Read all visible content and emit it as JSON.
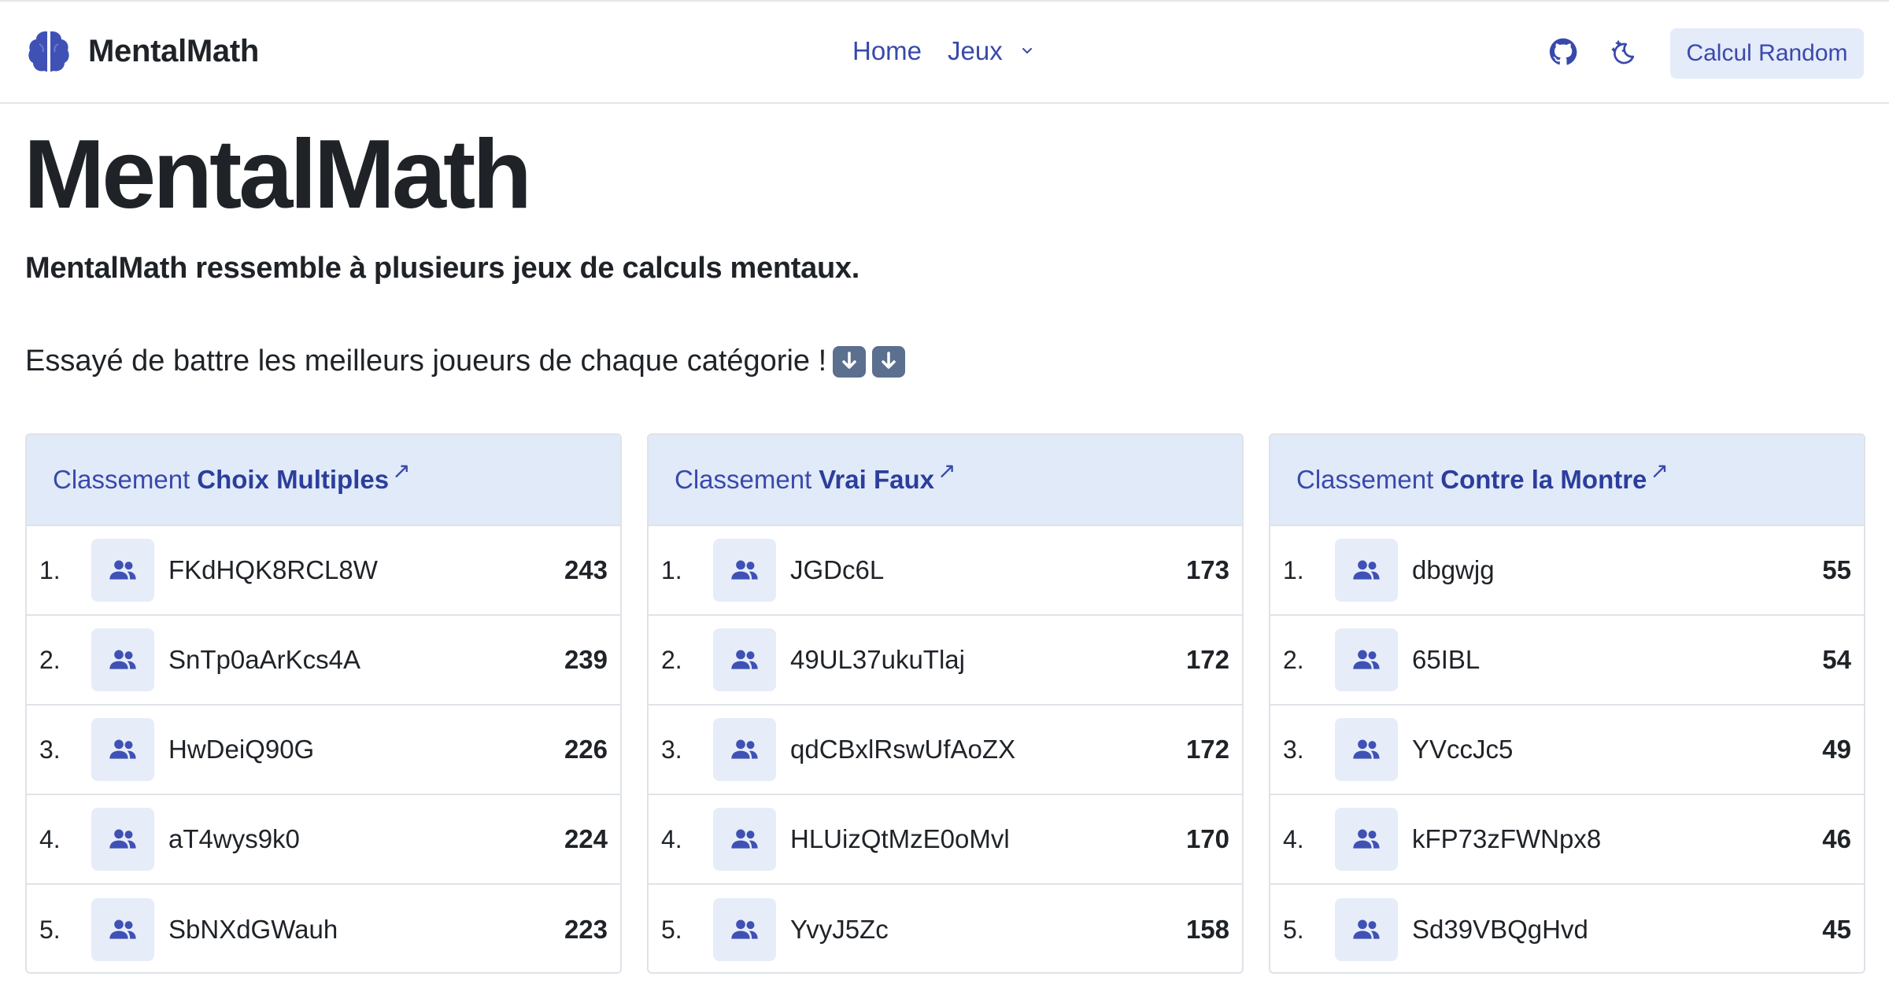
{
  "app": {
    "name": "MentalMath"
  },
  "nav": {
    "home": "Home",
    "games": "Jeux",
    "cta": "Calcul Random"
  },
  "icons": {
    "logo": "brain-icon",
    "github": "github-icon",
    "theme": "moon-stars-icon",
    "dropdown": "chevron-down-icon",
    "player": "users-icon",
    "external": "arrow-up-right-icon",
    "emoji": "down-arrow-emoji"
  },
  "colors": {
    "accent": "#3949ab",
    "header_bg": "#e1eaf9",
    "button_bg": "#e4ebf9"
  },
  "hero": {
    "title": "MentalMath",
    "subtitle": "MentalMath ressemble à plusieurs jeux de calculs mentaux.",
    "cta_text": "Essayé de battre les meilleurs joueurs de chaque catégorie !"
  },
  "leaderboards": [
    {
      "prefix": "Classement",
      "name": "Choix Multiples",
      "arrow": "↗",
      "rows": [
        {
          "rank": "1.",
          "player": "FKdHQK8RCL8W",
          "score": "243"
        },
        {
          "rank": "2.",
          "player": "SnTp0aArKcs4A",
          "score": "239"
        },
        {
          "rank": "3.",
          "player": "HwDeiQ90G",
          "score": "226"
        },
        {
          "rank": "4.",
          "player": "aT4wys9k0",
          "score": "224"
        },
        {
          "rank": "5.",
          "player": "SbNXdGWauh",
          "score": "223"
        }
      ]
    },
    {
      "prefix": "Classement",
      "name": "Vrai Faux",
      "arrow": "↗",
      "rows": [
        {
          "rank": "1.",
          "player": "JGDc6L",
          "score": "173"
        },
        {
          "rank": "2.",
          "player": "49UL37ukuTlaj",
          "score": "172"
        },
        {
          "rank": "3.",
          "player": "qdCBxlRswUfAoZX",
          "score": "172"
        },
        {
          "rank": "4.",
          "player": "HLUizQtMzE0oMvl",
          "score": "170"
        },
        {
          "rank": "5.",
          "player": "YvyJ5Zc",
          "score": "158"
        }
      ]
    },
    {
      "prefix": "Classement",
      "name": "Contre la Montre",
      "arrow": "↗",
      "rows": [
        {
          "rank": "1.",
          "player": "dbgwjg",
          "score": "55"
        },
        {
          "rank": "2.",
          "player": "65IBL",
          "score": "54"
        },
        {
          "rank": "3.",
          "player": "YVccJc5",
          "score": "49"
        },
        {
          "rank": "4.",
          "player": "kFP73zFWNpx8",
          "score": "46"
        },
        {
          "rank": "5.",
          "player": "Sd39VBQgHvd",
          "score": "45"
        }
      ]
    }
  ]
}
